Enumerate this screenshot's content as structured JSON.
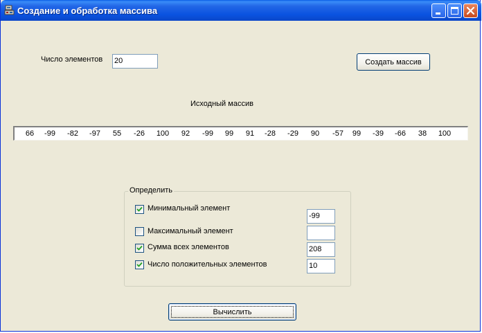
{
  "window": {
    "title": "Создание и обработка массива"
  },
  "count": {
    "label": "Число элементов",
    "value": "20"
  },
  "create_button": "Создать массив",
  "source_array": {
    "label": "Исходный массив",
    "values": [
      "66",
      "-99",
      "-82",
      "-97",
      "55",
      "-26",
      "100",
      "92",
      "-99",
      "99",
      "91",
      "-28",
      "-29",
      "90",
      "-57",
      "99",
      "-39",
      "-66",
      "38",
      "100"
    ]
  },
  "group": {
    "caption": "Определить",
    "options": [
      {
        "label": "Минимальный элемент",
        "checked": true,
        "result": "-99"
      },
      {
        "label": "Максимальный элемент",
        "checked": false,
        "result": ""
      },
      {
        "label": "Сумма всех элементов",
        "checked": true,
        "result": "208"
      },
      {
        "label": "Число положительных элементов",
        "checked": true,
        "result": "10"
      }
    ]
  },
  "calculate_button": "Вычислить",
  "colors": {
    "titlebar": "#0a53e0",
    "window_bg": "#ece9d8",
    "close_button": "#c84a1f"
  },
  "icons": [
    "app-icon",
    "minimize-icon",
    "maximize-icon",
    "close-icon",
    "checkmark-icon"
  ]
}
